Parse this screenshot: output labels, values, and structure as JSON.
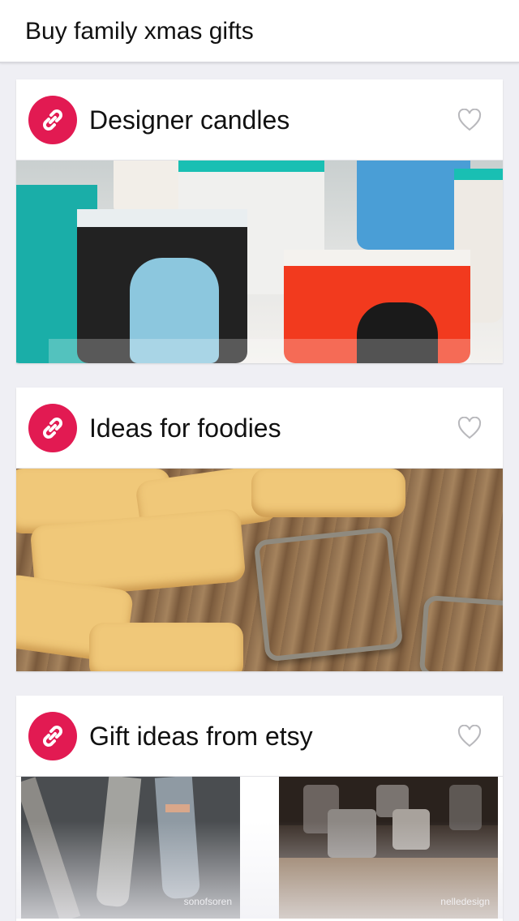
{
  "header": {
    "title": "Buy family xmas gifts"
  },
  "cards": [
    {
      "title": "Designer candles"
    },
    {
      "title": "Ideas for foodies"
    },
    {
      "title": "Gift ideas from etsy",
      "thumbs": [
        {
          "caption": "sonofsoren"
        },
        {
          "caption": "nelledesign"
        }
      ]
    }
  ],
  "icons": {
    "link": "link-icon",
    "favorite": "heart-outline-icon"
  },
  "colors": {
    "accent": "#e21a52",
    "background": "#efeff4"
  }
}
